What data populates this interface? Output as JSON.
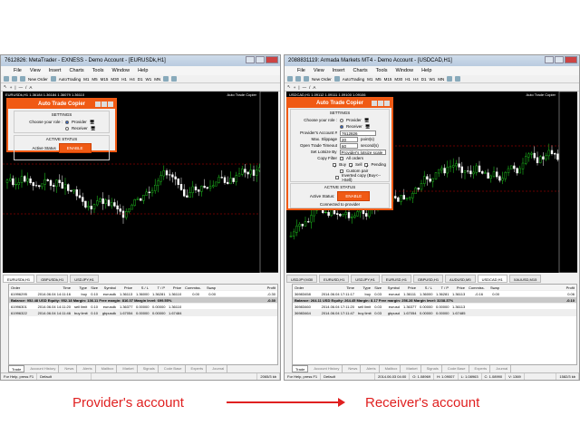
{
  "colors": {
    "accent": "#f05a14",
    "bull": "#22dd22",
    "bear": "#ffffff",
    "caption": "#e02020"
  },
  "menu": [
    "File",
    "View",
    "Insert",
    "Charts",
    "Tools",
    "Window",
    "Help"
  ],
  "toolbar": {
    "new_order": "New Order",
    "autotrading": "AutoTrading",
    "timeframes": [
      "M1",
      "M5",
      "M15",
      "M30",
      "H1",
      "H4",
      "D1",
      "W1",
      "MN"
    ]
  },
  "terminal_columns": [
    "Order",
    "Time",
    "Type",
    "Size",
    "Symbol",
    "Price",
    "S / L",
    "T / P",
    "Price",
    "Commiss...",
    "Swap",
    "Profit"
  ],
  "terminal_tabs": [
    "Trade",
    "Account History",
    "News",
    "Alerts",
    "Mailbox",
    "Market",
    "Signals",
    "Code Base",
    "Experts",
    "Journal"
  ],
  "left": {
    "title": "7612826: MetaTrader - EXNESS - Demo Account - [EURUSDk,H1]",
    "symbol_line": "EURUSDk,H1  1.36184 1.36184 1.36079 1.36110",
    "ea_label": "Auto Trade Copier",
    "chart_tabs": [
      "EURUSDk,H1",
      "GBPUSDk,H1",
      "USDJPY,H1"
    ],
    "dialog": {
      "title": "Auto Trade Copier",
      "settings": "SETTINGS",
      "role_label": "Choose your role :",
      "provider": "Provider",
      "receiver": "Receiver",
      "active_status_title": "ACTIVE STATUS",
      "active_status_label": "Active Status",
      "enable": "ENABLE",
      "message": "Trades on this account is sending out"
    },
    "rows": [
      [
        "61996295",
        "2014.06.04 14:11:16",
        "buy",
        "0.10",
        "eurusdk",
        "1.36113",
        "1.36000",
        "1.36281",
        "1.36110",
        "0.00",
        "0.00",
        "-0.30"
      ],
      [
        "61996301",
        "2014.06.04 14:11:20",
        "sell limit",
        "0.10",
        "eurusdk",
        "1.36377",
        "0.00000",
        "0.00000",
        "1.36110",
        "",
        "",
        ""
      ],
      [
        "61996322",
        "2014.06.04 14:11:46",
        "buy limit",
        "0.10",
        "gbpusdk",
        "1.67054",
        "0.00000",
        "0.00000",
        "1.67484",
        "",
        "",
        ""
      ]
    ],
    "balance": "Balance: 952.48 USD  Equity: 952.18  Margin: 136.11  Free margin: 816.07  Margin level: 699.55%",
    "balance_profit": "-0.30",
    "status": [
      "For Help, press F1",
      "Default"
    ],
    "traffic": "2065/3 kb"
  },
  "right": {
    "title": "2088831119: Armada Markets MT4 - Demo Account - [USDCAD,H1]",
    "symbol_line": "USDCAD,H1  1.09112 1.09111 1.09100 1.09106",
    "ea_label": "Auto Trade Copier",
    "chart_tabs": [
      "USDJPY,M30",
      "EURUSD,H1",
      "USDJPY,H1",
      "EURUSD,H1",
      "GBPUSD,H1",
      "AUDUSD,M5",
      "USDCAD,H1",
      "XAUUSD,M15"
    ],
    "dialog": {
      "title": "Auto Trade Copier",
      "settings": "SETTINGS",
      "role_label": "Choose your role :",
      "provider": "Provider",
      "receiver": "Receiver",
      "account_label": "Provider's Account #",
      "account_value": "7612826",
      "slippage_label": "Max. Slippage",
      "slippage_value": "20",
      "slippage_unit": "point(s)",
      "timeout_label": "Open Trade Timeout",
      "timeout_value": "60",
      "timeout_unit": "second(s)",
      "lotsize_label": "Set Lotsize By",
      "lotsize_value": "Provider's lotsize scale",
      "filter_label": "Copy Filter",
      "all_orders": "All orders",
      "buy": "Buy",
      "sell": "Sell",
      "pending": "Pending",
      "custom_pair": "Custom pair",
      "inverted": "Inverted copy (Buy<-->Sell)",
      "active_status_title": "ACTIVE STATUS",
      "active_status_label": "Active Status:",
      "enable": "ENABLE",
      "message": "Connected to provider"
    },
    "rows": [
      [
        "36983458",
        "2014.06.04 17:11:17",
        "buy",
        "0.03",
        "eurusd",
        "1.36111",
        "1.36000",
        "1.36281",
        "1.36113",
        "-0.16",
        "0.00",
        "0.06"
      ],
      [
        "36983460",
        "2014.06.04 17:11:20",
        "sell limit",
        "0.03",
        "eurusd",
        "1.36377",
        "0.00000",
        "0.00000",
        "1.36113",
        "",
        "",
        ""
      ],
      [
        "36983464",
        "2014.06.04 17:11:47",
        "buy limit",
        "0.03",
        "gbpusd",
        "1.67054",
        "0.00000",
        "0.00000",
        "1.67485",
        "",
        "",
        ""
      ]
    ],
    "balance": "Balance: 264.11 USD  Equity: 264.45  Margin: 8.17  Free margin: 256.28  Margin level: 3238.37%",
    "balance_profit": "-0.10",
    "status": [
      "For Help, press F1",
      "Default",
      "2014.06.03 04:00",
      "O: 1.08969",
      "H: 1.09007",
      "L: 1.08963",
      "C: 1.08990",
      "V: 1369"
    ],
    "traffic": "1582/3 kb"
  },
  "captions": {
    "provider": "Provider's account",
    "receiver": "Receiver's account"
  }
}
